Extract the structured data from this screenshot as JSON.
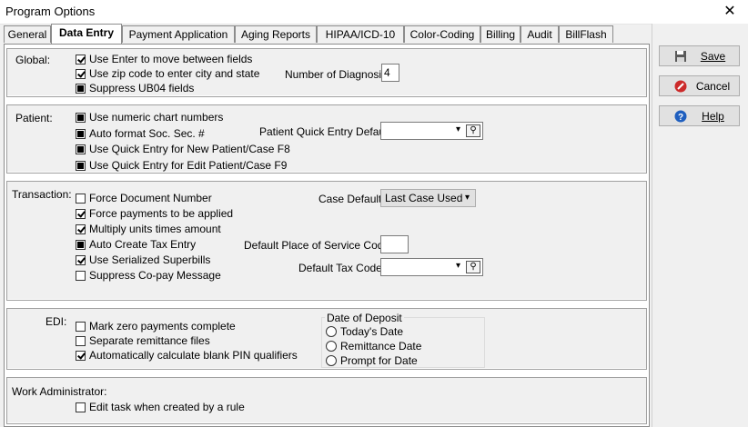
{
  "window": {
    "title": "Program Options"
  },
  "tabs": [
    {
      "label": "General"
    },
    {
      "label": "Data Entry"
    },
    {
      "label": "Payment Application"
    },
    {
      "label": "Aging Reports"
    },
    {
      "label": "HIPAA/ICD-10"
    },
    {
      "label": "Color-Coding"
    },
    {
      "label": "Billing"
    },
    {
      "label": "Audit"
    },
    {
      "label": "BillFlash"
    }
  ],
  "global": {
    "label": "Global:",
    "use_enter": "Use Enter to move between fields",
    "use_zip": "Use zip code to enter city and state",
    "suppress_ub04": "Suppress UB04 fields",
    "num_diag_label": "Number of Diagnosis:",
    "num_diag_value": "4"
  },
  "patient": {
    "label": "Patient:",
    "numeric_chart": "Use numeric chart numbers",
    "auto_format_ssn": "Auto format Soc. Sec. #",
    "quick_entry_new": "Use Quick Entry for New Patient/Case F8",
    "quick_entry_edit": "Use Quick Entry for Edit Patient/Case F9",
    "quick_entry_default_label": "Patient Quick Entry Default:"
  },
  "transaction": {
    "label": "Transaction:",
    "force_doc": "Force Document Number",
    "force_payments": "Force payments to be applied",
    "multiply_units": "Multiply units times amount",
    "auto_tax": "Auto Create Tax Entry",
    "serialized": "Use Serialized Superbills",
    "suppress_copay": "Suppress Co-pay Message",
    "case_default_label": "Case Default:",
    "case_default_value": "Last Case Used",
    "pos_label": "Default Place of Service Code:",
    "tax_code_label": "Default Tax Code:"
  },
  "edi": {
    "label": "EDI:",
    "mark_zero": "Mark zero payments complete",
    "separate_remit": "Separate remittance files",
    "auto_pin": "Automatically calculate blank PIN qualifiers",
    "deposit_group": "Date of Deposit",
    "todays_date": "Today's Date",
    "remittance_date": "Remittance Date",
    "prompt_date": "Prompt for Date"
  },
  "work_admin": {
    "label": "Work Administrator:",
    "edit_task": "Edit task when created by a rule"
  },
  "buttons": {
    "save": "Save",
    "cancel": "Cancel",
    "help": "Help"
  },
  "colors": {
    "accent_blue": "#1f5fbf",
    "cancel_red": "#cc2a2a"
  }
}
